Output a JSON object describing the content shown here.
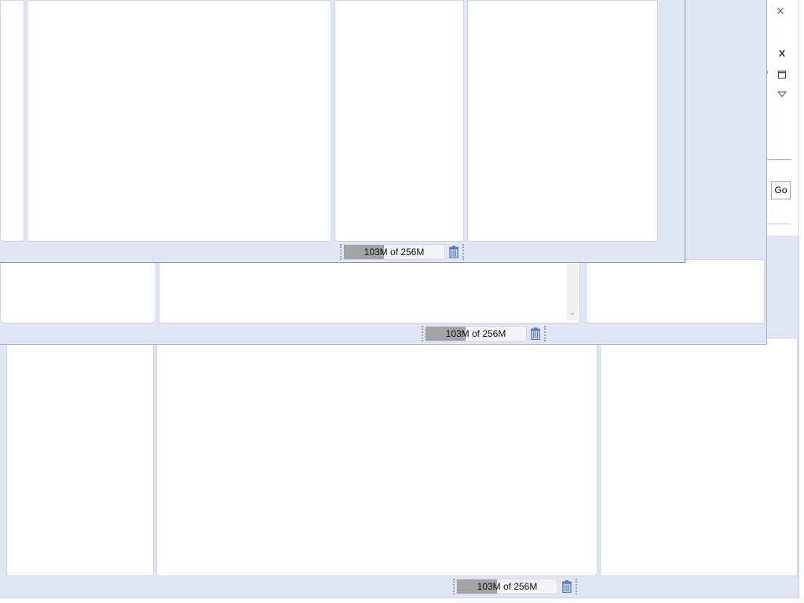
{
  "heap_status": {
    "label": "103M of 256M",
    "used_mb": 103,
    "total_mb": 256,
    "used_fraction": 0.402
  },
  "side_panel": {
    "close_glyph": "×",
    "x_button_glyph": "x",
    "go_button_label": "Go"
  },
  "icons": {
    "close": "close-icon",
    "restore": "restore-icon",
    "view-menu": "view-menu-icon",
    "gc": "trash-icon"
  },
  "colors": {
    "window_bg": "#e1e6f6",
    "heap_fill": "#a3a3a3",
    "trash_icon": "#5b79b6"
  }
}
